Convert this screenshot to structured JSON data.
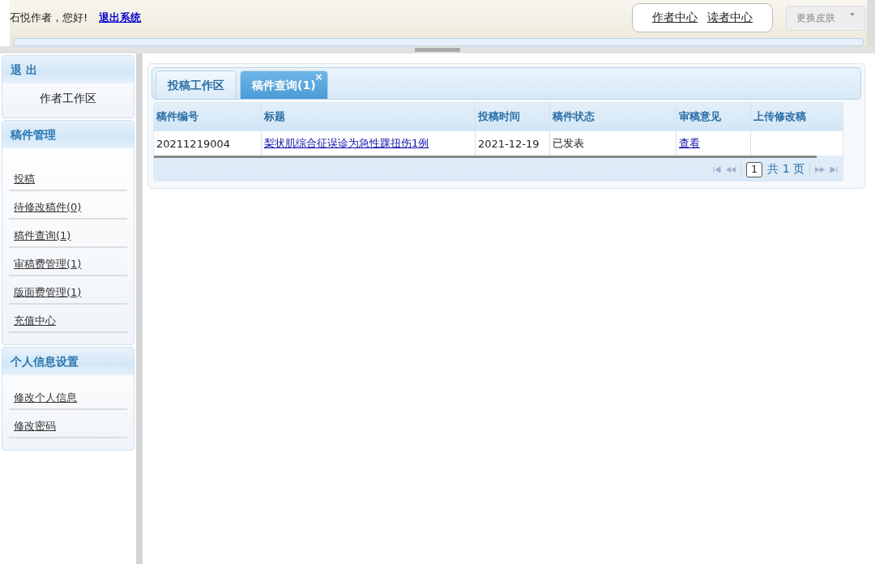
{
  "header": {
    "greeting": "石悦作者，您好!",
    "logout_link": "退出系统",
    "center_links": [
      "作者中心",
      "读者中心"
    ],
    "skin_button": "更换皮肤"
  },
  "sidebar": {
    "panels": [
      {
        "title": "退 出",
        "items": [
          {
            "label": "作者工作区",
            "kind": "plain"
          }
        ]
      },
      {
        "title": "稿件管理",
        "items": [
          {
            "label": "投稿",
            "kind": "link"
          },
          {
            "label": "待修改稿件(0)",
            "kind": "link"
          },
          {
            "label": "稿件查询(1)",
            "kind": "link"
          },
          {
            "label": "审稿费管理(1)",
            "kind": "link"
          },
          {
            "label": "版面费管理(1)",
            "kind": "link"
          },
          {
            "label": "充值中心",
            "kind": "link"
          }
        ]
      },
      {
        "title": "个人信息设置",
        "items": [
          {
            "label": "修改个人信息",
            "kind": "link"
          },
          {
            "label": "修改密码",
            "kind": "link"
          }
        ]
      }
    ]
  },
  "tabs": [
    {
      "label": "投稿工作区",
      "selected": false
    },
    {
      "label": "稿件查询(1)",
      "selected": true,
      "close": "×"
    }
  ],
  "table": {
    "columns": [
      "稿件编号",
      "标题",
      "投稿时间",
      "稿件状态",
      "审稿意见",
      "上传修改稿"
    ],
    "rows": [
      {
        "number": "20211219004",
        "title": "梨状肌综合征误诊为急性踝扭伤1例",
        "date": "2021-12-19",
        "status": "已发表",
        "review": "查看"
      }
    ]
  },
  "pagination": {
    "page": "1",
    "total": "共 1 页"
  }
}
